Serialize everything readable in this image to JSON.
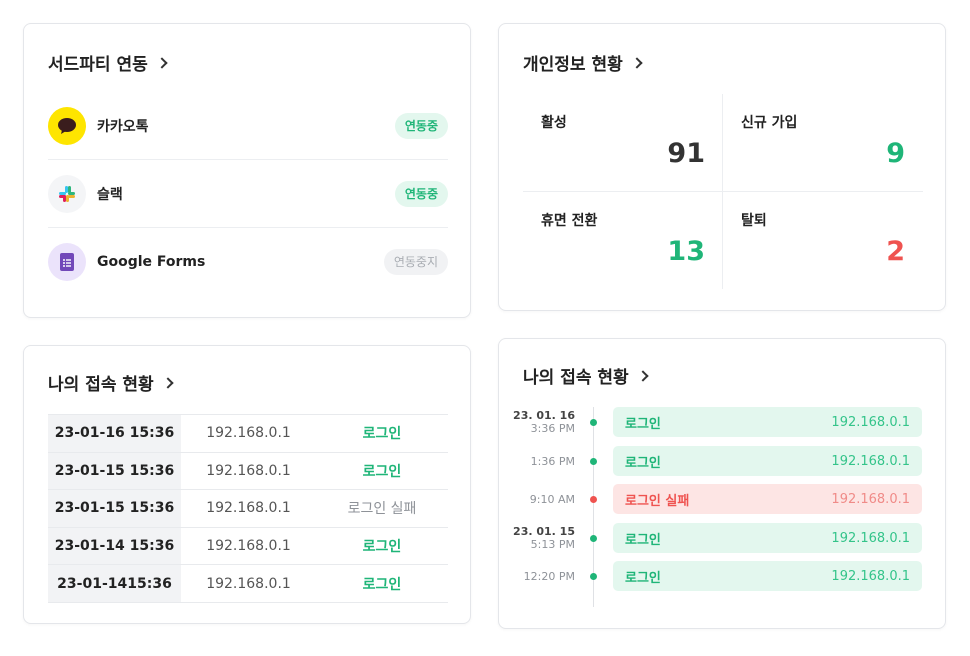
{
  "third_party": {
    "title": "서드파티 연동",
    "items": [
      {
        "name": "카카오톡",
        "status": "연동중",
        "icon": "kakaotalk-icon"
      },
      {
        "name": "슬랙",
        "status": "연동중",
        "icon": "slack-icon"
      },
      {
        "name": "Google Forms",
        "status": "연동중지",
        "icon": "google-forms-icon"
      }
    ]
  },
  "personal_info": {
    "title": "개인정보 현황",
    "stats": [
      {
        "label": "활성",
        "value": "91",
        "color": "#333333"
      },
      {
        "label": "신규 가입",
        "value": "9",
        "color": "#1fb578"
      },
      {
        "label": "휴면 전환",
        "value": "13",
        "color": "#1fb578"
      },
      {
        "label": "탈퇴",
        "value": "2",
        "color": "#ef5350"
      }
    ]
  },
  "access_table": {
    "title": "나의 접속 현황",
    "rows": [
      {
        "time": "23-01-16 15:36",
        "ip": "192.168.0.1",
        "status": "로그인"
      },
      {
        "time": "23-01-15 15:36",
        "ip": "192.168.0.1",
        "status": "로그인"
      },
      {
        "time": "23-01-15 15:36",
        "ip": "192.168.0.1",
        "status": "로그인 실패"
      },
      {
        "time": "23-01-14 15:36",
        "ip": "192.168.0.1",
        "status": "로그인"
      },
      {
        "time": "23-01-1415:36",
        "ip": "192.168.0.1",
        "status": "로그인"
      }
    ]
  },
  "access_timeline": {
    "title": "나의 접속 현황",
    "entries": [
      {
        "date": "23. 01. 16",
        "time": "3:36 PM",
        "status": "로그인",
        "ip": "192.168.0.1"
      },
      {
        "date": "",
        "time": "1:36 PM",
        "status": "로그인",
        "ip": "192.168.0.1"
      },
      {
        "date": "",
        "time": "9:10 AM",
        "status": "로그인 실패",
        "ip": "192.168.0.1"
      },
      {
        "date": "23. 01. 15",
        "time": "5:13 PM",
        "status": "로그인",
        "ip": "192.168.0.1"
      },
      {
        "date": "",
        "time": "12:20 PM",
        "status": "로그인",
        "ip": "192.168.0.1"
      }
    ]
  }
}
